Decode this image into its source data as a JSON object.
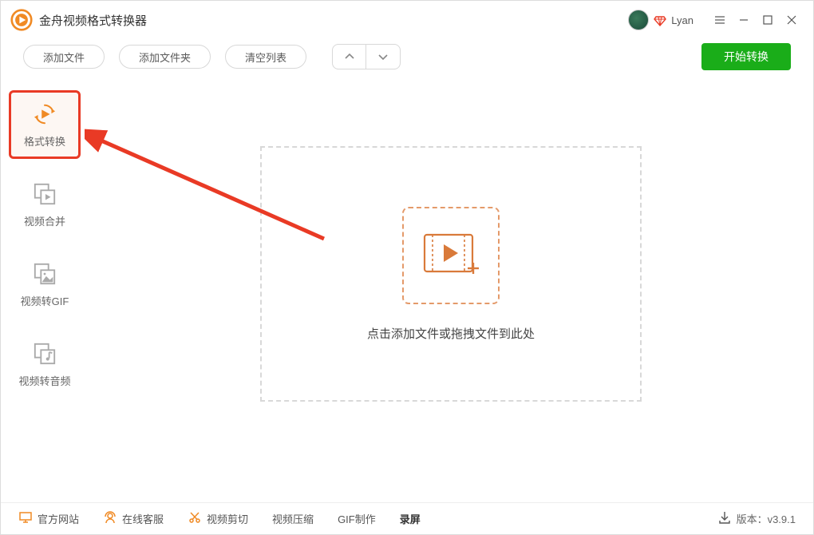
{
  "titlebar": {
    "app_title": "金舟视频格式转换器",
    "username": "Lyan"
  },
  "toolbar": {
    "add_file": "添加文件",
    "add_folder": "添加文件夹",
    "clear_list": "清空列表",
    "start_convert": "开始转换"
  },
  "sidebar": {
    "items": [
      {
        "label": "格式转换"
      },
      {
        "label": "视频合并"
      },
      {
        "label": "视频转GIF"
      },
      {
        "label": "视频转音频"
      }
    ]
  },
  "dropzone": {
    "hint": "点击添加文件或拖拽文件到此处"
  },
  "footer": {
    "official": "官方网站",
    "support": "在线客服",
    "crop": "视频剪切",
    "compress": "视频压缩",
    "gif": "GIF制作",
    "record": "录屏",
    "version_label": "版本：v3.9.1"
  },
  "colors": {
    "accent_orange": "#f08a24",
    "highlight_red": "#e93a25",
    "start_green": "#1aad19"
  }
}
